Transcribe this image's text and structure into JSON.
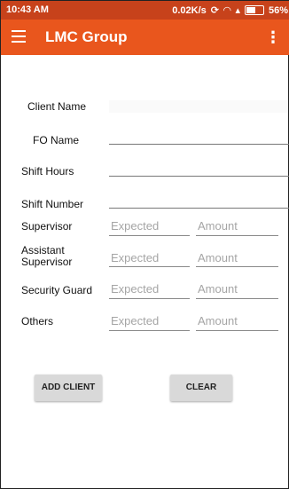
{
  "status_bar": {
    "time": "10:43 AM",
    "network_speed": "0.02K/s",
    "battery": "56%"
  },
  "app_bar": {
    "title": "LMC Group",
    "menu_icon": "hamburger-menu-icon",
    "overflow_icon": "more-vertical-icon"
  },
  "form": {
    "client_name_label": "Client Name",
    "fo_name_label": "FO Name",
    "shift_hours_label": "Shift Hours",
    "shift_number_label": "Shift Number",
    "supervisor_label": "Supervisor",
    "assistant_supervisor_label": "Assistant Supervisor",
    "security_guard_label": "Security Guard",
    "others_label": "Others",
    "expected_placeholder": "Expected",
    "amount_placeholder": "Amount"
  },
  "buttons": {
    "add_client": "ADD CLIENT",
    "clear": "CLEAR"
  },
  "colors": {
    "status_bar": "#c7421b",
    "app_bar": "#e9561d"
  }
}
